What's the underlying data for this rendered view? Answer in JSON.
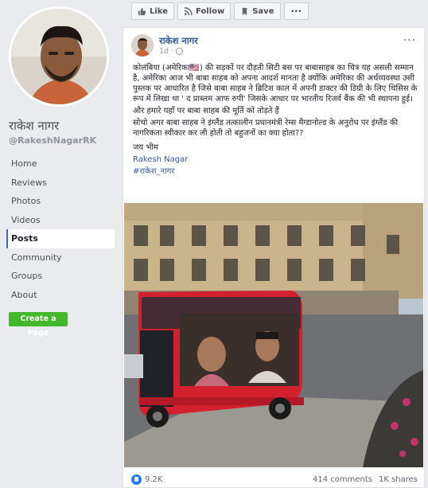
{
  "page": {
    "name": "राकेश नागर",
    "handle": "@RakeshNagarRK",
    "create_page_label": "Create a Page"
  },
  "nav": [
    {
      "label": "Home"
    },
    {
      "label": "Reviews"
    },
    {
      "label": "Photos"
    },
    {
      "label": "Videos"
    },
    {
      "label": "Posts",
      "active": true
    },
    {
      "label": "Community"
    },
    {
      "label": "Groups"
    },
    {
      "label": "About"
    }
  ],
  "actions": {
    "like": "Like",
    "follow": "Follow",
    "save": "Save",
    "more": "···"
  },
  "post": {
    "author": "राकेश नागर",
    "time": "1d ·",
    "options": "···",
    "para1": "कोलंबिया (अमेरिका🇺🇸) की सड़कों पर दौड़ती सिटी बस पर बाबासाहब का चित्र यह असली सम्मान है, अमेरिका आज भी बाबा साहब को अपना आदर्श मानता है क्योंकि अमेरिका की अर्थव्यवस्था उसी पुस्तक पर आधारित है जिसे बाबा साहब ने ब्रिटिश काल में अपनी डाक्टर की डिग्री के लिए थिसिस के रूप में लिखा था ' द प्राब्लम आफ रुपी' जिसके आधार पर भारतीय रिजर्व बैंक की भी स्थापना हुई।",
    "para2": "और हमारे यहाँ पर बाबा साहब की मूर्ति को तोड़ते हैं",
    "para3": "सोचो अगर बाबा साहब ने इंग्लैंड तत्कालीन प्रधानमंत्री रेम्स मैग्डानोल्ड के अनुरोध पर इंग्लैंड की नागरिकता स्वीकार कर ली होती तो बहुजनों का क्या होता??",
    "sign1": "जय भीम",
    "sign2": "Rakesh Nagar",
    "hashtag": "#राकेश_नागर"
  },
  "stats": {
    "reactions": "9.2K",
    "comments": "414 comments",
    "shares": "1K shares"
  }
}
